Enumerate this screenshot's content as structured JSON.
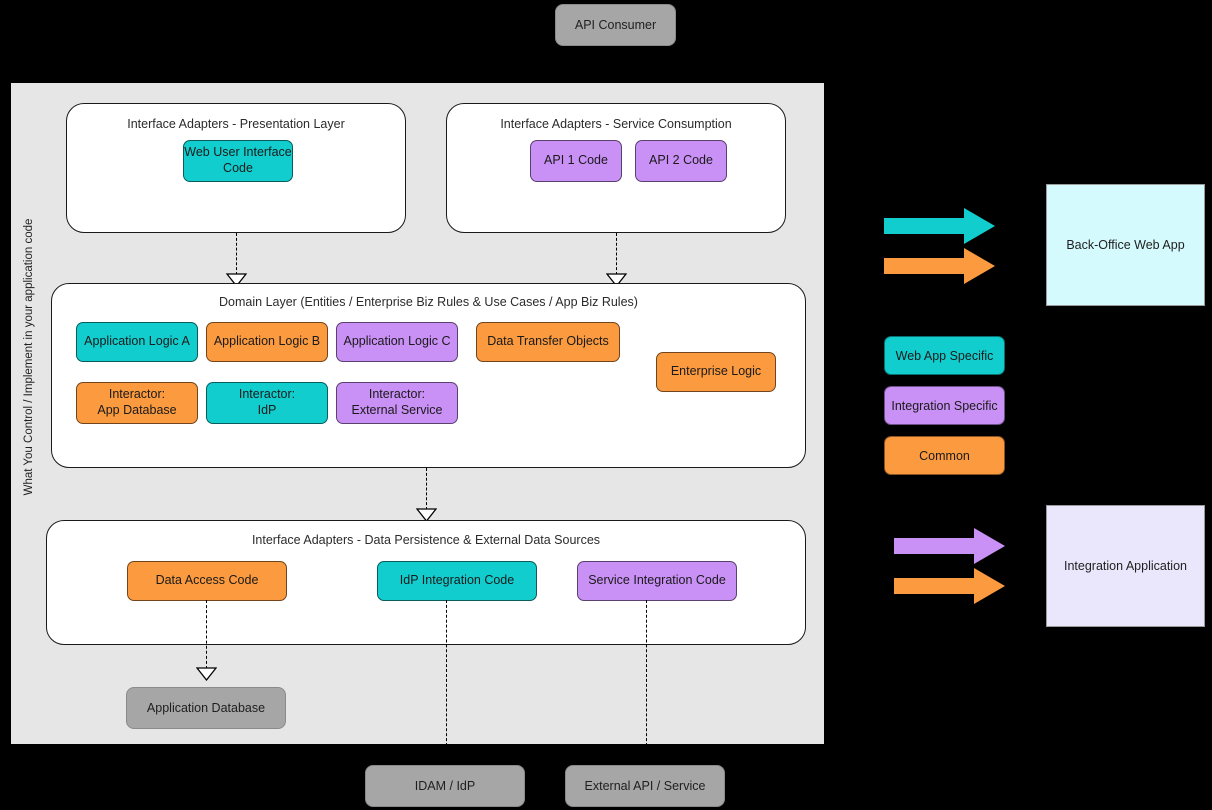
{
  "diagram": {
    "title_vertical": "What You Control / Implement in your application code",
    "colors": {
      "teal": "#12CDCD",
      "orange": "#FB9A3F",
      "purple": "#C990F5",
      "gray_external": "#A6A6A6",
      "container_bg": "#E6E6E6",
      "backoffice_bg": "#D4FAFD",
      "integration_bg": "#EAE7FC",
      "page_bg": "#000000"
    }
  },
  "top": {
    "api_consumer": "API Consumer"
  },
  "presentation_panel": {
    "title": "Interface Adapters - Presentation Layer",
    "nodes": [
      {
        "label": "Web User Interface\nCode",
        "color_key": "teal"
      }
    ]
  },
  "service_panel": {
    "title": "Interface Adapters - Service Consumption",
    "nodes": [
      {
        "label": "API 1 Code",
        "color_key": "purple"
      },
      {
        "label": "API 2 Code",
        "color_key": "purple"
      }
    ]
  },
  "domain_panel": {
    "title": "Domain Layer (Entities / Enterprise Biz Rules & Use Cases / App Biz Rules)",
    "row1": [
      {
        "label": "Application Logic A",
        "color_key": "teal"
      },
      {
        "label": "Application Logic B",
        "color_key": "orange"
      },
      {
        "label": "Application Logic C",
        "color_key": "purple"
      },
      {
        "label": "Data Transfer Objects",
        "color_key": "orange"
      }
    ],
    "row2": [
      {
        "label": "Interactor:\nApp Database",
        "color_key": "orange"
      },
      {
        "label": "Interactor:\nIdP",
        "color_key": "teal"
      },
      {
        "label": "Interactor:\nExternal Service",
        "color_key": "purple"
      }
    ],
    "floating": [
      {
        "label": "Enterprise Logic",
        "color_key": "orange"
      }
    ]
  },
  "persistence_panel": {
    "title": "Interface Adapters - Data Persistence & External Data Sources",
    "nodes": [
      {
        "label": "Data Access Code",
        "color_key": "orange"
      },
      {
        "label": "IdP Integration Code",
        "color_key": "teal"
      },
      {
        "label": "Service Integration Code",
        "color_key": "purple"
      }
    ]
  },
  "external_systems": [
    {
      "label": "Application Database"
    },
    {
      "label": "IDAM / IdP"
    },
    {
      "label": "External API / Service"
    }
  ],
  "legend": {
    "backoffice": {
      "app_label": "Back-Office Web App",
      "arrows": [
        {
          "color_key": "teal"
        },
        {
          "color_key": "orange"
        }
      ]
    },
    "integration": {
      "app_label": "Integration Application",
      "arrows": [
        {
          "color_key": "purple"
        },
        {
          "color_key": "orange"
        }
      ]
    },
    "swatches": [
      {
        "label": "Web App Specific",
        "color_key": "teal"
      },
      {
        "label": "Integration Specific",
        "color_key": "purple"
      },
      {
        "label": "Common",
        "color_key": "orange"
      }
    ]
  }
}
